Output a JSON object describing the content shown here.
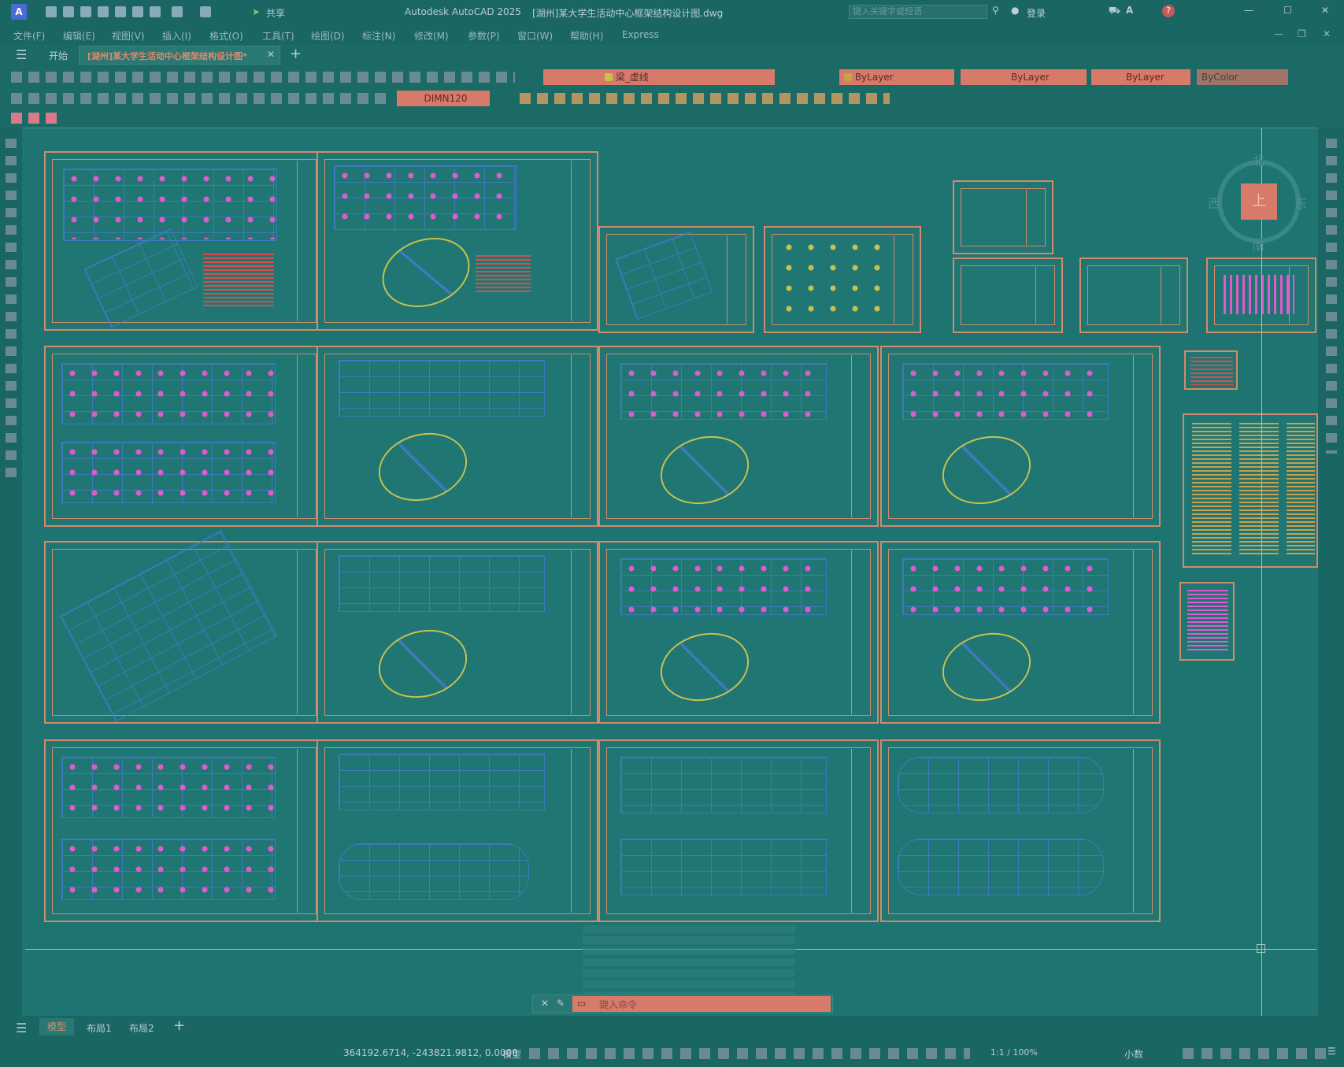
{
  "app": {
    "title": "Autodesk AutoCAD 2025",
    "filename": "[湖州]某大学生活动中心框架结构设计图.dwg",
    "share_label": "共享",
    "search_placeholder": "键入关键字或短语",
    "login_label": "登录"
  },
  "menu": [
    "文件(F)",
    "编辑(E)",
    "视图(V)",
    "插入(I)",
    "格式(O)",
    "工具(T)",
    "绘图(D)",
    "标注(N)",
    "修改(M)",
    "参数(P)",
    "窗口(W)",
    "帮助(H)",
    "Express"
  ],
  "tabs": {
    "start": "开始",
    "doc": "[湖州]某大学生活动中心框架结构设计图*"
  },
  "properties": {
    "layer": "梁_虚线",
    "color": "ByLayer",
    "linetype": "ByLayer",
    "lineweight": "ByLayer",
    "plotstyle": "ByColor",
    "dimstyle": "DIMN120"
  },
  "viewcube": {
    "north": "北",
    "south": "南",
    "east": "东",
    "west": "西",
    "top": "上"
  },
  "command": {
    "placeholder": "键入命令"
  },
  "layout_tabs": [
    "模型",
    "布局1",
    "布局2"
  ],
  "status": {
    "coords": "364192.6714, -243821.9812, 0.0000",
    "mode": "模型",
    "scale": "1:1 / 100%",
    "units": "小数"
  },
  "colors": {
    "background": "#1e7470",
    "sheet_border": "#d48a6a",
    "grid": "#4a7bd8",
    "column": "#e05ad0",
    "accent": "#d87a6a"
  }
}
